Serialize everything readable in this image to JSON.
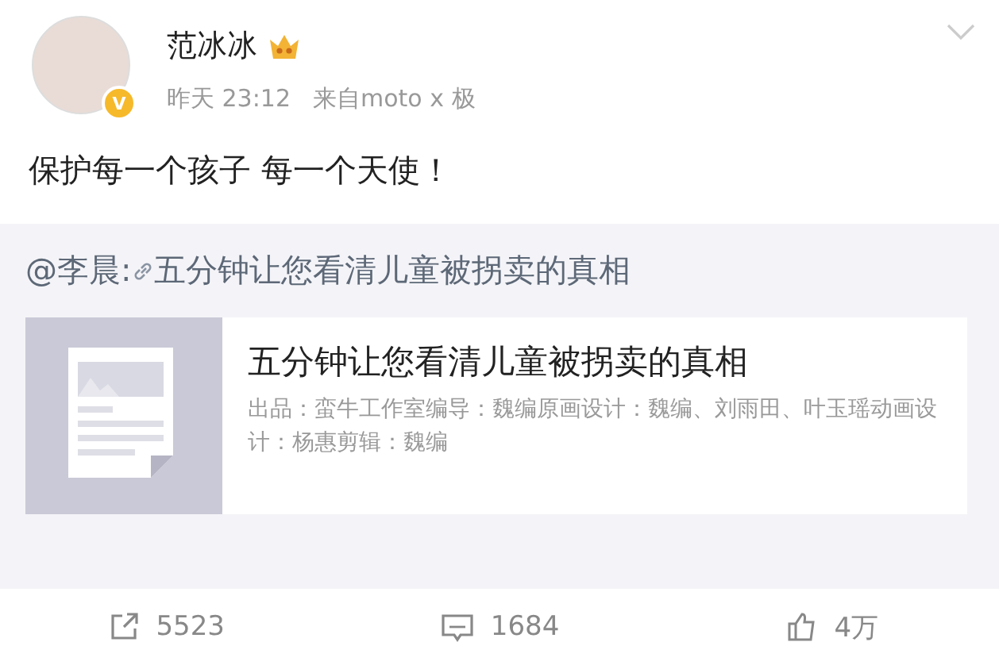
{
  "post": {
    "author": "范冰冰",
    "verified_badge": "V",
    "time": "昨天 23:12",
    "source": "来自moto x 极",
    "text": "保护每一个孩子 每一个天使！"
  },
  "repost": {
    "mention": "@李晨:",
    "link_text": "五分钟让您看清儿童被拐卖的真相",
    "card": {
      "title": "五分钟让您看清儿童被拐卖的真相",
      "description": "出品：蛮牛工作室编导：魏编原画设计：魏编、刘雨田、叶玉瑶动画设计：杨惠剪辑：魏编"
    }
  },
  "actions": [
    {
      "kind": "repost",
      "count": "5523"
    },
    {
      "kind": "comment",
      "count": "1684"
    },
    {
      "kind": "like",
      "count": "4万"
    }
  ]
}
